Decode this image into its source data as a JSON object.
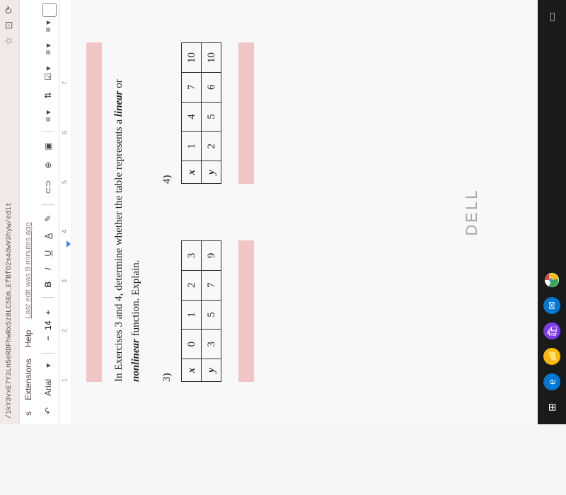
{
  "browser": {
    "url": "/1kY3vxE7Y3Ln5eRDFhwRx5z8LC5Em_EfBfO2s4dwV3hyw/edit"
  },
  "menubar": {
    "items": [
      "s",
      "Extensions",
      "Help"
    ],
    "edit_status": "Last edit was 9 minutes ago"
  },
  "toolbar": {
    "font": "Arial",
    "font_size": "14",
    "minus": "−",
    "plus": "+",
    "bold": "B",
    "italic": "I",
    "underline": "U",
    "text_color": "A"
  },
  "ruler": {
    "marks": [
      "1",
      "2",
      "3",
      "4",
      "5",
      "6",
      "7"
    ]
  },
  "document": {
    "instruction_prefix": "In Exercises 3 and 4, determine whether the table represents a ",
    "instruction_linear": "linear",
    "instruction_or": " or ",
    "instruction_nonlinear": "nonlinear",
    "instruction_suffix": " function. Explain.",
    "exercises": [
      {
        "num": "3)",
        "rows": [
          {
            "hdr": "x",
            "cells": [
              "0",
              "1",
              "2",
              "3"
            ]
          },
          {
            "hdr": "y",
            "cells": [
              "3",
              "5",
              "7",
              "9"
            ]
          }
        ]
      },
      {
        "num": "4)",
        "rows": [
          {
            "hdr": "x",
            "cells": [
              "1",
              "4",
              "7",
              "10"
            ]
          },
          {
            "hdr": "y",
            "cells": [
              "2",
              "5",
              "6",
              "10"
            ]
          }
        ]
      }
    ]
  },
  "dell": "DELL"
}
